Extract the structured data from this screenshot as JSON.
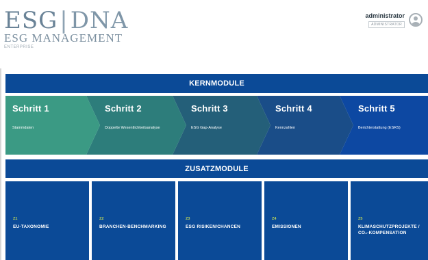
{
  "brand": {
    "logo_esg": "ESG",
    "logo_separator": "|",
    "logo_dna": "DNA",
    "subtitle": "ESG MANAGEMENT",
    "edition": "ENTERPRISE"
  },
  "user": {
    "name": "administrator",
    "role": "ADMINISTRATOR",
    "avatar_icon": "user-avatar-icon"
  },
  "kernmodule": {
    "heading": "KERNMODULE",
    "steps": [
      {
        "title": "Schritt 1",
        "description": "Stammdaten",
        "color": "#3b9a84"
      },
      {
        "title": "Schritt 2",
        "description": "Doppelte Wesentlichkeitsanalyse",
        "color": "#2d7d7b"
      },
      {
        "title": "Schritt 3",
        "description": "ESG Gap-Analyse",
        "color": "#245f79"
      },
      {
        "title": "Schritt 4",
        "description": "Kennzahlen",
        "color": "#1a4d88"
      },
      {
        "title": "Schritt 5",
        "description": "Berichterstattung (ESRS)",
        "color": "#0d48a2"
      }
    ]
  },
  "zusatzmodule": {
    "heading": "ZUSATZMODULE",
    "modules": [
      {
        "number": "Z1",
        "label": "EU-TAXONOMIE"
      },
      {
        "number": "Z2",
        "label": "BRANCHEN-BENCHMARKING"
      },
      {
        "number": "Z3",
        "label": "ESG RISIKEN/CHANCEN"
      },
      {
        "number": "Z4",
        "label": "EMISSIONEN"
      },
      {
        "number": "Z5",
        "label": "KLIMASCHUTZPROJEKTE / CO₂-KOMPENSATION"
      }
    ]
  },
  "colors": {
    "primary_blue": "#0b4a97",
    "accent_green": "#b9d35a",
    "logo_gray": "#7f96a8"
  }
}
